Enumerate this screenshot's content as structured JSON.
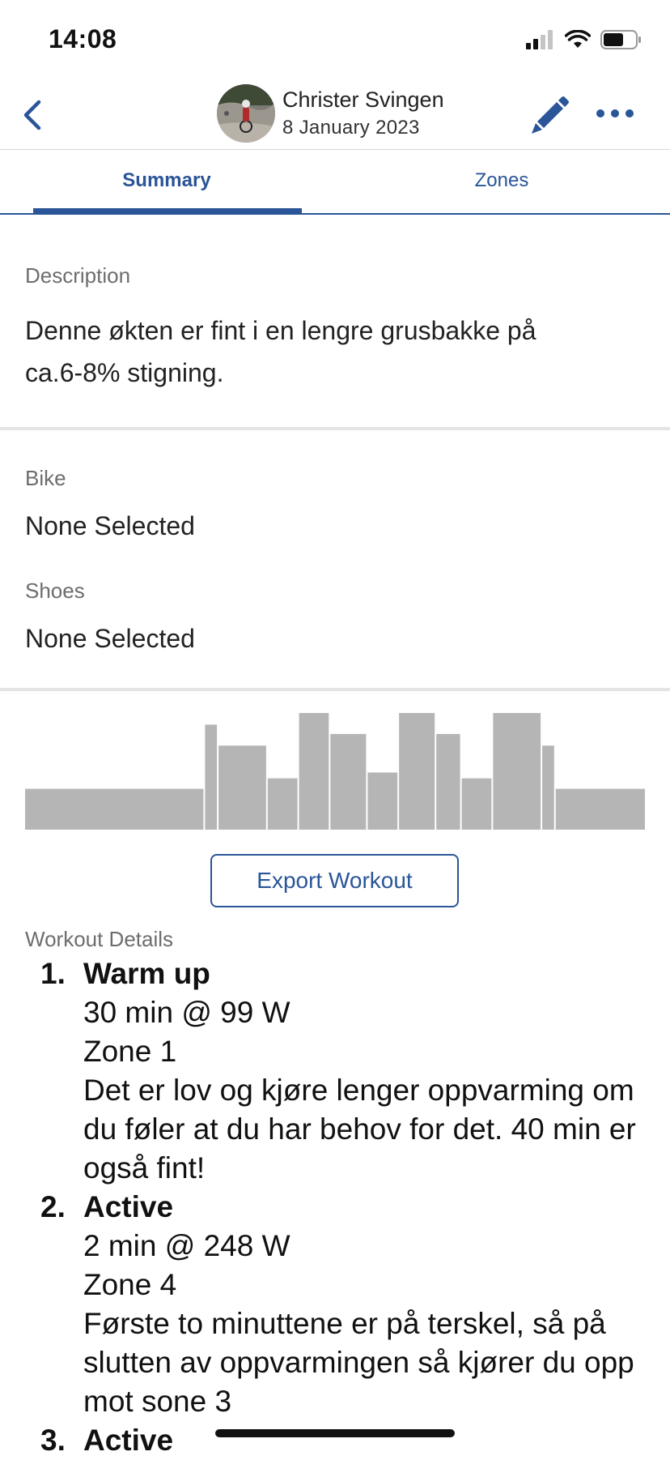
{
  "status_bar": {
    "time": "14:08"
  },
  "header": {
    "athlete_name": "Christer Svingen",
    "date": "8 January 2023"
  },
  "tabs": [
    {
      "label": "Summary",
      "active": true
    },
    {
      "label": "Zones",
      "active": false
    }
  ],
  "description": {
    "label": "Description",
    "text_line1": "Denne økten er fint i en lengre grusbakke på",
    "text_line2": "ca.6-8% stigning."
  },
  "equipment": {
    "bike_label": "Bike",
    "bike_value": "None Selected",
    "shoes_label": "Shoes",
    "shoes_value": "None Selected"
  },
  "chart_data": {
    "type": "bar",
    "title": "",
    "xlabel": "",
    "ylabel": "",
    "note": "Relative intensity blocks of the workout profile (relative heights, 0-100 scale); widths proportional to block durations",
    "ylim": [
      0,
      100
    ],
    "values": [
      35,
      90,
      72,
      44,
      100,
      82,
      49,
      100,
      82,
      44,
      100,
      72,
      35
    ],
    "durations": [
      30,
      2,
      8,
      5,
      5,
      6,
      5,
      6,
      4,
      5,
      8,
      2,
      15
    ],
    "color": "#b5b5b5"
  },
  "export_button": {
    "label": "Export Workout"
  },
  "workout_details": {
    "label": "Workout Details",
    "steps": [
      {
        "number": "1.",
        "title": "Warm up",
        "target": "30 min @ 99 W",
        "zone": "Zone 1",
        "notes": "Det er lov og kjøre lenger oppvarming om du føler at du har behov for det. 40 min er også fint!"
      },
      {
        "number": "2.",
        "title": "Active",
        "target": "2 min @ 248 W",
        "zone": "Zone 4",
        "notes": "Første to minuttene er på terskel, så på slutten av oppvarmingen så kjører du opp mot sone 3"
      },
      {
        "number": "3.",
        "title": "Active"
      }
    ]
  },
  "colors": {
    "accent": "#2a5598",
    "chart_bar": "#b5b5b5",
    "divider": "#e4e4e4"
  },
  "icons": {
    "back": "chevron-left-icon",
    "edit": "pencil-icon",
    "more": "ellipsis-icon",
    "signal": "cellular-signal-icon",
    "wifi": "wifi-icon",
    "battery": "battery-icon"
  }
}
